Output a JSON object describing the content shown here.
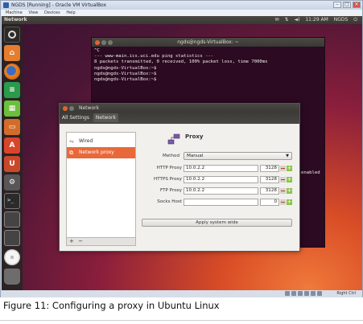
{
  "virtualbox": {
    "title": "NGDS [Running] - Oracle VM VirtualBox",
    "menu": [
      "Machine",
      "View",
      "Devices",
      "Help"
    ],
    "host_key": "Right Ctrl"
  },
  "ubuntu": {
    "panel_title": "Network",
    "time": "11:29 AM",
    "user": "NGDS"
  },
  "terminal": {
    "title": "ngds@ngds-VirtualBox: ~",
    "lines": [
      "^C",
      "--- www-main.ics.uci.edu ping statistics ---",
      "8 packets transmitted, 0 received, 100% packet loss, time 7000ms",
      "",
      "ngds@ngds-VirtualBox:~$",
      "ngds@ngds-VirtualBox:~$",
      "ngds@ngds-VirtualBox:~$"
    ],
    "hidden_text": "enabled"
  },
  "network": {
    "window_title": "Network",
    "breadcrumb": [
      "All Settings",
      "Network"
    ],
    "sidebar": [
      {
        "label": "Wired",
        "icon": "wired-icon"
      },
      {
        "label": "Network proxy",
        "icon": "proxy-icon"
      }
    ],
    "controls": {
      "add": "+",
      "remove": "−"
    },
    "pane_title": "Proxy",
    "method_label": "Method",
    "method_value": "Manual",
    "fields": [
      {
        "label": "HTTP Proxy",
        "host": "10.0.2.2",
        "port": "3128"
      },
      {
        "label": "HTTPS Proxy",
        "host": "10.0.2.2",
        "port": "3128"
      },
      {
        "label": "FTP Proxy",
        "host": "10.0.2.2",
        "port": "3128"
      },
      {
        "label": "Socks Host",
        "host": "",
        "port": "0"
      }
    ],
    "apply_label": "Apply system wide"
  },
  "caption": "Figure 11: Configuring a proxy in Ubuntu Linux"
}
